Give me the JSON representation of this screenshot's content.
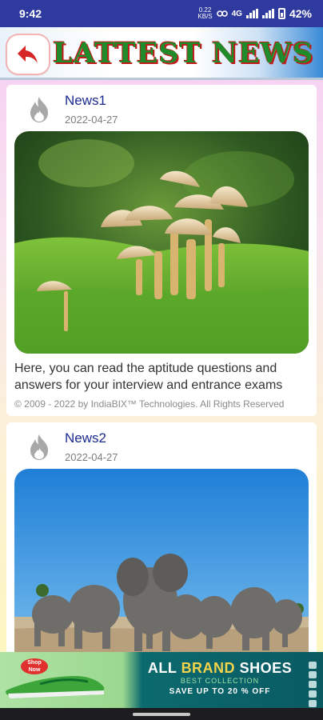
{
  "status": {
    "time": "9:42",
    "data_rate": "0.22",
    "data_unit": "KB/S",
    "network": "4G",
    "battery": "42%"
  },
  "header": {
    "title": "LATTEST NEWS",
    "back_icon": "back-arrow-icon"
  },
  "news": [
    {
      "title": "News1",
      "date": "2022-04-27",
      "icon": "fire-icon",
      "description": "Here, you can read the aptitude questions and answers for your interview and entrance exams",
      "copyright": "© 2009 - 2022 by IndiaBIX™ Technologies. All Rights Reserved"
    },
    {
      "title": "News2",
      "date": "2022-04-27",
      "icon": "fire-icon"
    }
  ],
  "ad": {
    "shop_now": "Shop Now",
    "headline_part1": "ALL ",
    "headline_part2": "BRAND",
    "headline_part3": " SHOES",
    "subline": "BEST COLLECTION",
    "offer": "SAVE UP TO 20 % OFF"
  }
}
